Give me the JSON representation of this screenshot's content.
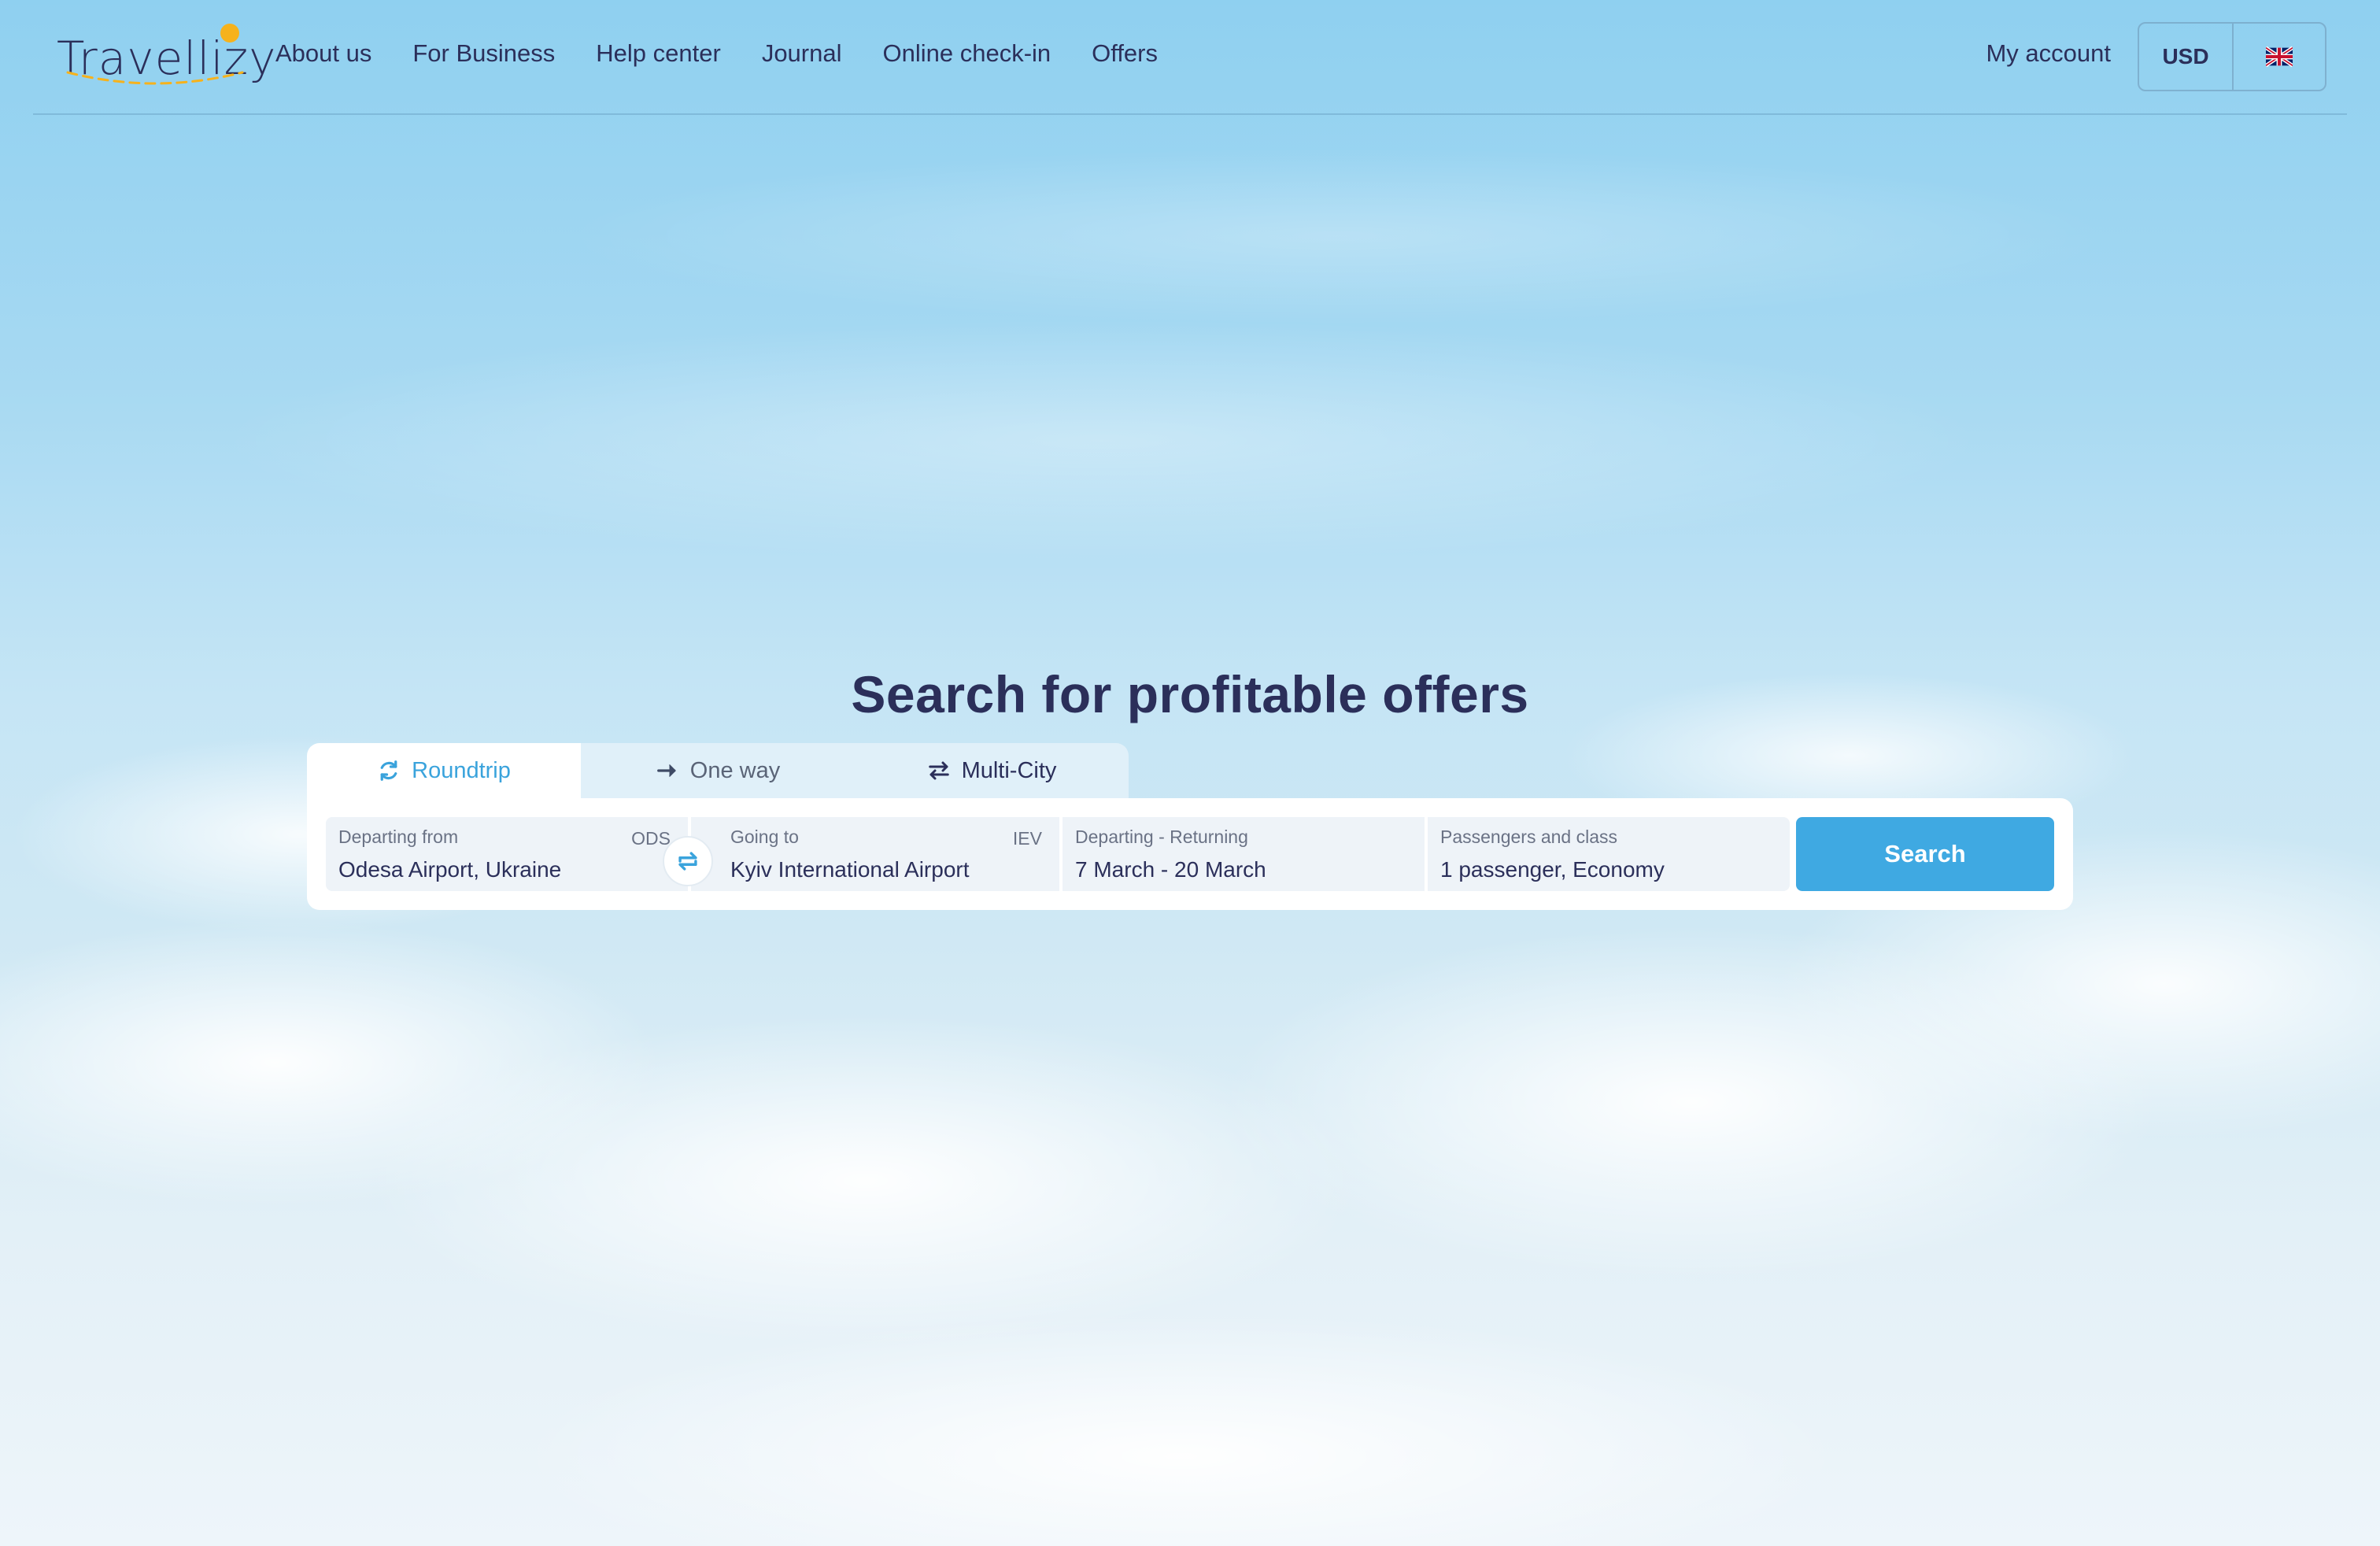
{
  "brand": {
    "name": "Travellizy",
    "colors": {
      "accent": "#3fa9e2",
      "text": "#2b2f5a",
      "logo_sun": "#f6b21c"
    }
  },
  "nav": {
    "items": [
      {
        "label": "About us"
      },
      {
        "label": "For Business"
      },
      {
        "label": "Help center"
      },
      {
        "label": "Journal"
      },
      {
        "label": "Online check-in"
      },
      {
        "label": "Offers"
      }
    ]
  },
  "account": {
    "label": "My account"
  },
  "currency": {
    "selected": "USD"
  },
  "language": {
    "icon": "uk-flag-icon"
  },
  "hero": {
    "title": "Search for profitable offers"
  },
  "trip_types": [
    {
      "label": "Roundtrip",
      "icon": "roundtrip-icon",
      "active": true
    },
    {
      "label": "One way",
      "icon": "arrow-right-icon",
      "active": false
    },
    {
      "label": "Multi-City",
      "icon": "multi-city-icon",
      "active": false
    }
  ],
  "search": {
    "from": {
      "label": "Departing from",
      "value": "Odesa Airport, Ukraine",
      "code": "ODS"
    },
    "to": {
      "label": "Going to",
      "value": "Kyiv International Airport",
      "code": "IEV"
    },
    "dates": {
      "label": "Departing - Returning",
      "value": "7 March - 20 March"
    },
    "passengers": {
      "label": "Passengers and class",
      "value": "1 passenger, Economy"
    },
    "swap_icon": "swap-icon",
    "button_label": "Search"
  }
}
